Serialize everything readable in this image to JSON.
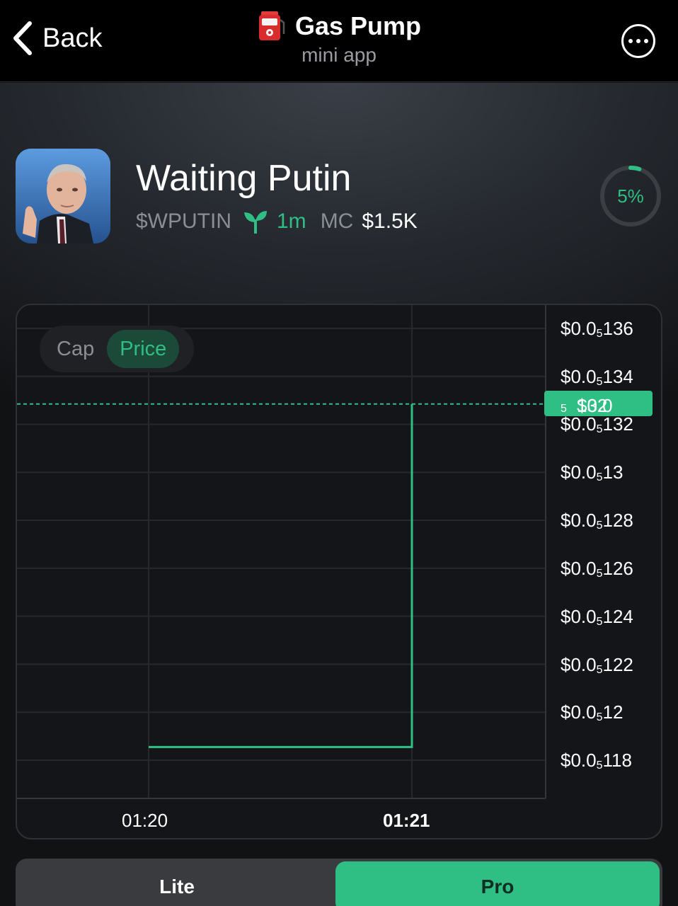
{
  "header": {
    "back_label": "Back",
    "title": "Gas Pump",
    "subtitle": "mini app"
  },
  "token": {
    "name": "Waiting Putin",
    "ticker": "$WPUTIN",
    "age": "1m",
    "mc_label": "MC",
    "mc_value": "$1.5K",
    "progress_text": "5%",
    "progress_value": 5
  },
  "chart_toggle": {
    "cap_label": "Cap",
    "price_label": "Price",
    "active": "Price"
  },
  "chart_data": {
    "type": "line",
    "y_tick_labels": [
      {
        "prefix": "$0.0",
        "sub": "5",
        "suffix": "136"
      },
      {
        "prefix": "$0.0",
        "sub": "5",
        "suffix": "134"
      },
      {
        "prefix": "$0.0",
        "sub": "5",
        "suffix": "132"
      },
      {
        "prefix": "$0.0",
        "sub": "5",
        "suffix": "13"
      },
      {
        "prefix": "$0.0",
        "sub": "5",
        "suffix": "128"
      },
      {
        "prefix": "$0.0",
        "sub": "5",
        "suffix": "126"
      },
      {
        "prefix": "$0.0",
        "sub": "5",
        "suffix": "124"
      },
      {
        "prefix": "$0.0",
        "sub": "5",
        "suffix": "122"
      },
      {
        "prefix": "$0.0",
        "sub": "5",
        "suffix": "12"
      },
      {
        "prefix": "$0.0",
        "sub": "5",
        "suffix": "118"
      }
    ],
    "y_values": [
      1.36,
      1.34,
      1.32,
      1.3,
      1.28,
      1.26,
      1.24,
      1.22,
      1.2,
      1.18
    ],
    "ylim": [
      1.18,
      1.36
    ],
    "x_tick_labels": [
      "01:20",
      "01:21"
    ],
    "series": [
      {
        "points": [
          {
            "x": "01:20",
            "y": 1.1855
          },
          {
            "x": "01:21",
            "y": 1.1855
          },
          {
            "x": "01:21",
            "y": 1.3285
          }
        ]
      }
    ],
    "current_price": {
      "prefix": "$0.0",
      "sub": "5",
      "suffix": "132",
      "value": 1.3285
    },
    "grid": true
  },
  "mode": {
    "lite_label": "Lite",
    "pro_label": "Pro",
    "active": "Pro"
  },
  "colors": {
    "accent": "#2fbf85",
    "background": "#111214",
    "topbar": "#000000"
  }
}
